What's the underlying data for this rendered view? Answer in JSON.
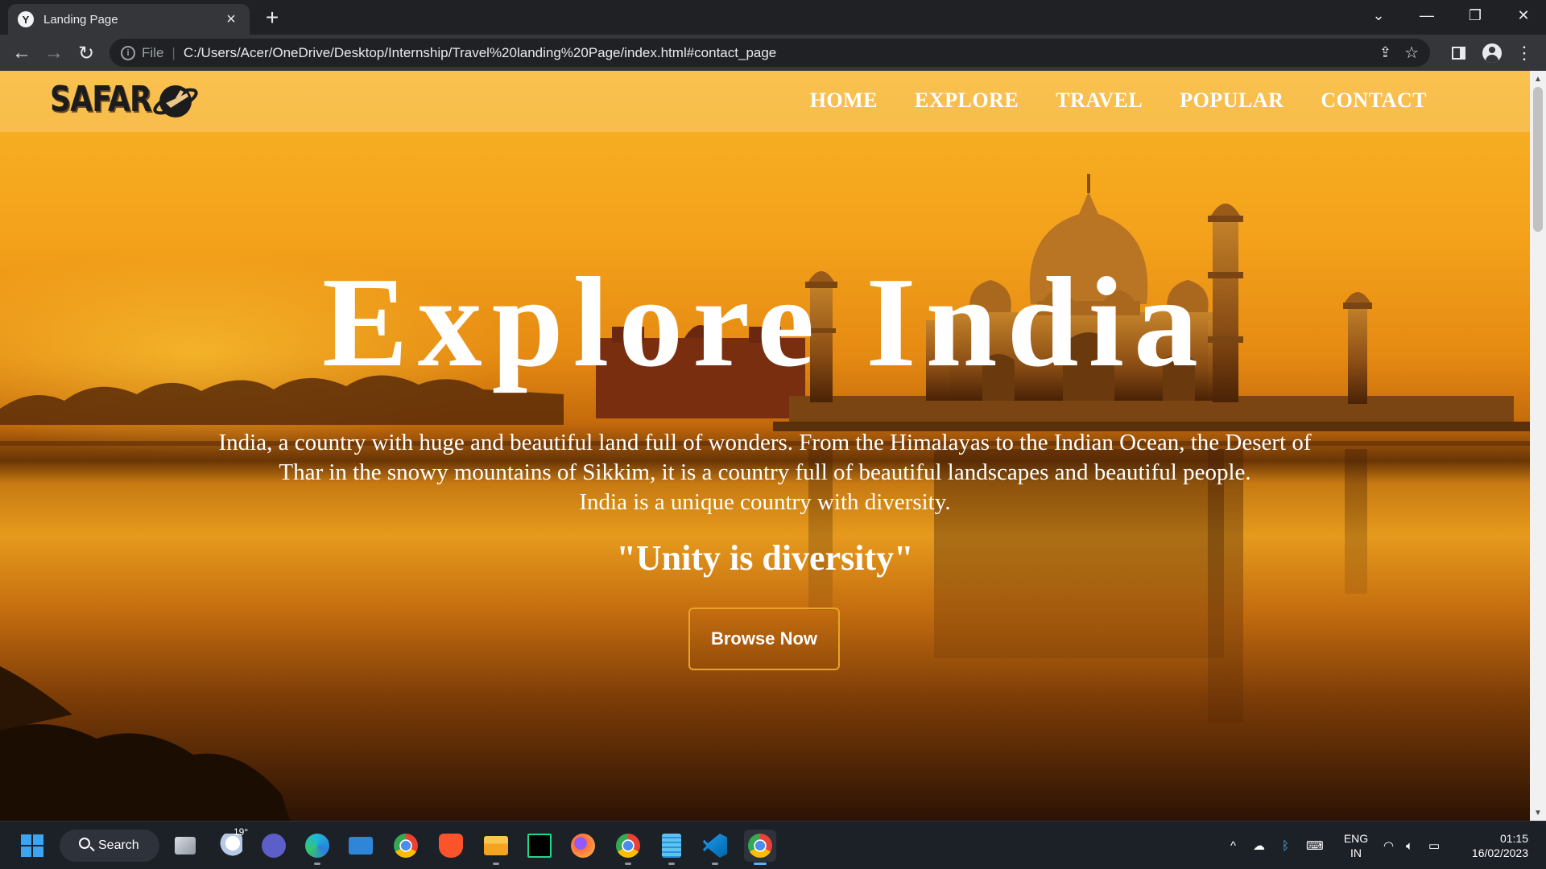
{
  "browser": {
    "tab_title": "Landing Page",
    "tab_favicon_letter": "Y",
    "url_scheme": "File",
    "url": "C:/Users/Acer/OneDrive/Desktop/Internship/Travel%20landing%20Page/index.html#contact_page",
    "icons": [
      "back-icon",
      "forward-icon",
      "reload-icon",
      "info-icon",
      "share-icon",
      "bookmark-star-icon",
      "side-panel-icon",
      "profile-icon",
      "menu-icon",
      "new-tab-icon",
      "tab-search-icon",
      "minimize-icon",
      "restore-icon",
      "close-icon"
    ]
  },
  "site": {
    "logo_text": "SAFAR",
    "nav": [
      {
        "label": "HOME"
      },
      {
        "label": "EXPLORE"
      },
      {
        "label": "TRAVEL"
      },
      {
        "label": "POPULAR"
      },
      {
        "label": "CONTACT"
      }
    ],
    "hero": {
      "title": "Explore India",
      "description_lines": [
        "India, a country with huge and beautiful land full of wonders. From the Himalayas to the Indian Ocean, the Desert of",
        "Thar in the snowy mountains of Sikkim, it is a country full of beautiful landscapes and beautiful people.",
        "India is a unique country with diversity."
      ],
      "quote": "\"Unity is diversity\"",
      "button_label": "Browse Now"
    },
    "colors": {
      "button_border": "#e7a327",
      "sky": "#f4a21b"
    }
  },
  "taskbar": {
    "search_label": "Search",
    "weather_temp": "19°",
    "apps": [
      "task-view-icon",
      "weather-icon",
      "teams-chat-icon",
      "edge-icon",
      "mail-icon",
      "chrome-icon",
      "brave-icon",
      "file-explorer-icon",
      "pycharm-icon",
      "firefox-icon",
      "chrome-profile-icon",
      "notepad-icon",
      "vscode-icon",
      "chrome-dev-icon"
    ],
    "lang_line1": "ENG",
    "lang_line2": "IN",
    "time": "01:15",
    "date": "16/02/2023"
  }
}
